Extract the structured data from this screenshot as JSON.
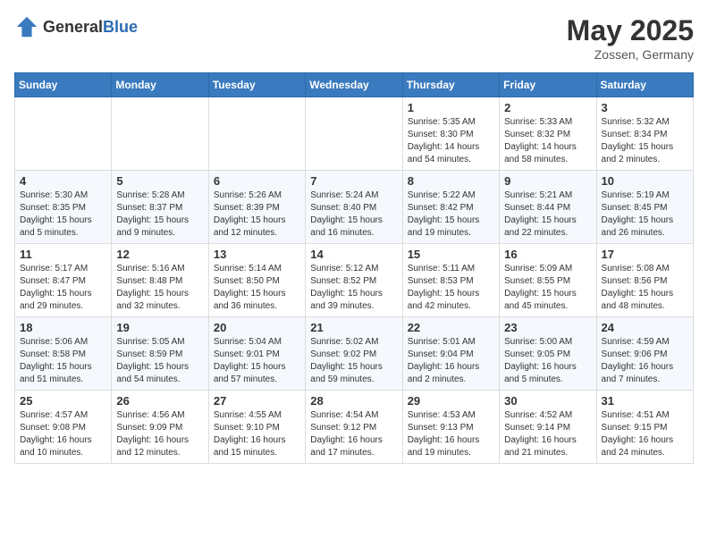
{
  "header": {
    "logo_general": "General",
    "logo_blue": "Blue",
    "month": "May 2025",
    "location": "Zossen, Germany"
  },
  "days_of_week": [
    "Sunday",
    "Monday",
    "Tuesday",
    "Wednesday",
    "Thursday",
    "Friday",
    "Saturday"
  ],
  "weeks": [
    [
      {
        "day": "",
        "info": ""
      },
      {
        "day": "",
        "info": ""
      },
      {
        "day": "",
        "info": ""
      },
      {
        "day": "",
        "info": ""
      },
      {
        "day": "1",
        "info": "Sunrise: 5:35 AM\nSunset: 8:30 PM\nDaylight: 14 hours\nand 54 minutes."
      },
      {
        "day": "2",
        "info": "Sunrise: 5:33 AM\nSunset: 8:32 PM\nDaylight: 14 hours\nand 58 minutes."
      },
      {
        "day": "3",
        "info": "Sunrise: 5:32 AM\nSunset: 8:34 PM\nDaylight: 15 hours\nand 2 minutes."
      }
    ],
    [
      {
        "day": "4",
        "info": "Sunrise: 5:30 AM\nSunset: 8:35 PM\nDaylight: 15 hours\nand 5 minutes."
      },
      {
        "day": "5",
        "info": "Sunrise: 5:28 AM\nSunset: 8:37 PM\nDaylight: 15 hours\nand 9 minutes."
      },
      {
        "day": "6",
        "info": "Sunrise: 5:26 AM\nSunset: 8:39 PM\nDaylight: 15 hours\nand 12 minutes."
      },
      {
        "day": "7",
        "info": "Sunrise: 5:24 AM\nSunset: 8:40 PM\nDaylight: 15 hours\nand 16 minutes."
      },
      {
        "day": "8",
        "info": "Sunrise: 5:22 AM\nSunset: 8:42 PM\nDaylight: 15 hours\nand 19 minutes."
      },
      {
        "day": "9",
        "info": "Sunrise: 5:21 AM\nSunset: 8:44 PM\nDaylight: 15 hours\nand 22 minutes."
      },
      {
        "day": "10",
        "info": "Sunrise: 5:19 AM\nSunset: 8:45 PM\nDaylight: 15 hours\nand 26 minutes."
      }
    ],
    [
      {
        "day": "11",
        "info": "Sunrise: 5:17 AM\nSunset: 8:47 PM\nDaylight: 15 hours\nand 29 minutes."
      },
      {
        "day": "12",
        "info": "Sunrise: 5:16 AM\nSunset: 8:48 PM\nDaylight: 15 hours\nand 32 minutes."
      },
      {
        "day": "13",
        "info": "Sunrise: 5:14 AM\nSunset: 8:50 PM\nDaylight: 15 hours\nand 36 minutes."
      },
      {
        "day": "14",
        "info": "Sunrise: 5:12 AM\nSunset: 8:52 PM\nDaylight: 15 hours\nand 39 minutes."
      },
      {
        "day": "15",
        "info": "Sunrise: 5:11 AM\nSunset: 8:53 PM\nDaylight: 15 hours\nand 42 minutes."
      },
      {
        "day": "16",
        "info": "Sunrise: 5:09 AM\nSunset: 8:55 PM\nDaylight: 15 hours\nand 45 minutes."
      },
      {
        "day": "17",
        "info": "Sunrise: 5:08 AM\nSunset: 8:56 PM\nDaylight: 15 hours\nand 48 minutes."
      }
    ],
    [
      {
        "day": "18",
        "info": "Sunrise: 5:06 AM\nSunset: 8:58 PM\nDaylight: 15 hours\nand 51 minutes."
      },
      {
        "day": "19",
        "info": "Sunrise: 5:05 AM\nSunset: 8:59 PM\nDaylight: 15 hours\nand 54 minutes."
      },
      {
        "day": "20",
        "info": "Sunrise: 5:04 AM\nSunset: 9:01 PM\nDaylight: 15 hours\nand 57 minutes."
      },
      {
        "day": "21",
        "info": "Sunrise: 5:02 AM\nSunset: 9:02 PM\nDaylight: 15 hours\nand 59 minutes."
      },
      {
        "day": "22",
        "info": "Sunrise: 5:01 AM\nSunset: 9:04 PM\nDaylight: 16 hours\nand 2 minutes."
      },
      {
        "day": "23",
        "info": "Sunrise: 5:00 AM\nSunset: 9:05 PM\nDaylight: 16 hours\nand 5 minutes."
      },
      {
        "day": "24",
        "info": "Sunrise: 4:59 AM\nSunset: 9:06 PM\nDaylight: 16 hours\nand 7 minutes."
      }
    ],
    [
      {
        "day": "25",
        "info": "Sunrise: 4:57 AM\nSunset: 9:08 PM\nDaylight: 16 hours\nand 10 minutes."
      },
      {
        "day": "26",
        "info": "Sunrise: 4:56 AM\nSunset: 9:09 PM\nDaylight: 16 hours\nand 12 minutes."
      },
      {
        "day": "27",
        "info": "Sunrise: 4:55 AM\nSunset: 9:10 PM\nDaylight: 16 hours\nand 15 minutes."
      },
      {
        "day": "28",
        "info": "Sunrise: 4:54 AM\nSunset: 9:12 PM\nDaylight: 16 hours\nand 17 minutes."
      },
      {
        "day": "29",
        "info": "Sunrise: 4:53 AM\nSunset: 9:13 PM\nDaylight: 16 hours\nand 19 minutes."
      },
      {
        "day": "30",
        "info": "Sunrise: 4:52 AM\nSunset: 9:14 PM\nDaylight: 16 hours\nand 21 minutes."
      },
      {
        "day": "31",
        "info": "Sunrise: 4:51 AM\nSunset: 9:15 PM\nDaylight: 16 hours\nand 24 minutes."
      }
    ]
  ]
}
